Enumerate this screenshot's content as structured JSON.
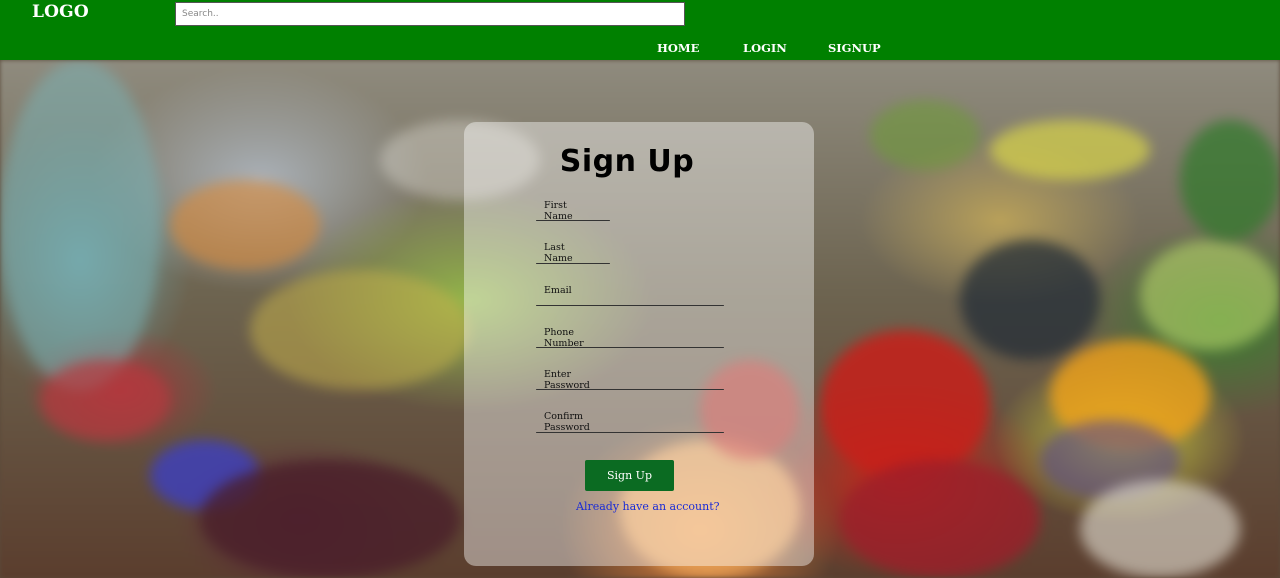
{
  "header": {
    "logo": "LOGO",
    "search_placeholder": "Search..",
    "nav": {
      "home": "HOME",
      "login": "LOGIN",
      "signup": "SIGNUP"
    },
    "color": "#008000"
  },
  "form": {
    "title": "Sign Up",
    "fields": {
      "first_name": "First Name",
      "last_name": "Last Name",
      "email": "Email",
      "phone": "Phone Number",
      "password": "Enter Password",
      "confirm_password": "Confirm Password"
    },
    "submit_label": "Sign Up",
    "login_link": "Already have an account?",
    "button_color": "#0b6b22"
  },
  "background": {
    "description_icon": "market-produce-photo"
  }
}
